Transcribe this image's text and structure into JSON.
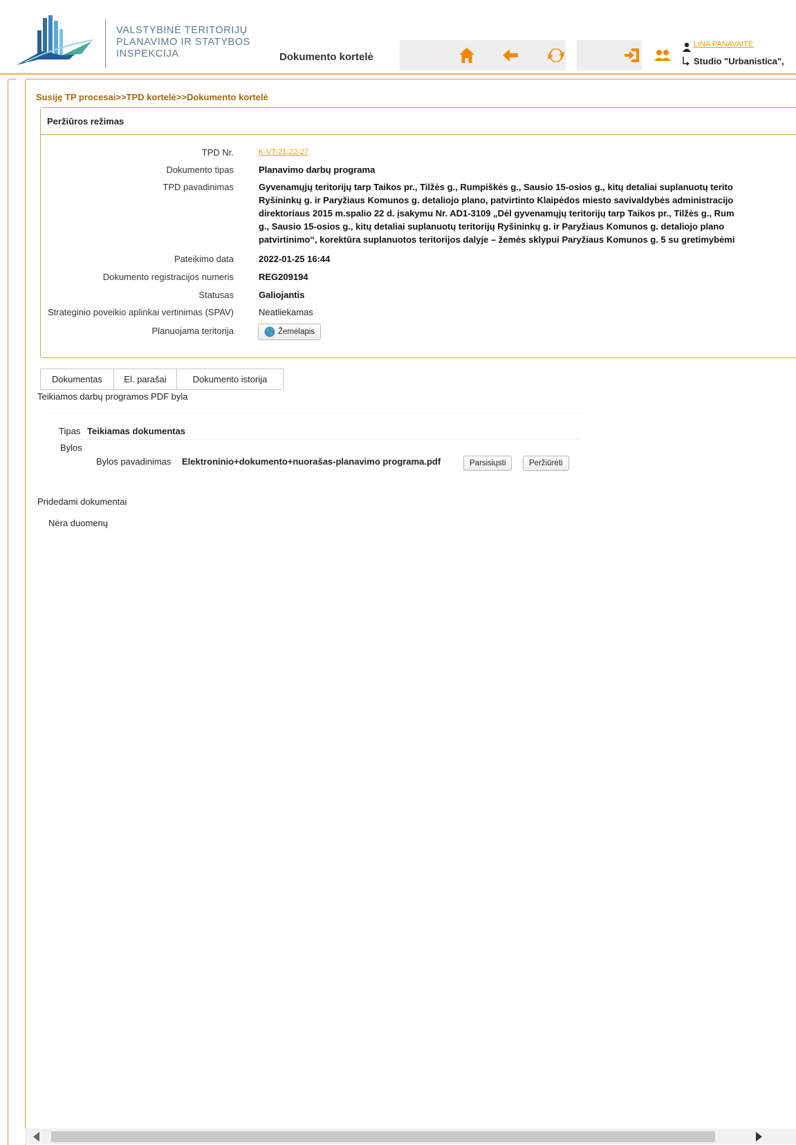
{
  "header": {
    "logo_lines": [
      "VALSTYBINĖ TERITORIJŲ",
      "PLANAVIMO IR STATYBOS",
      "INSPEKCIJA"
    ],
    "page_heading": "Dokumento kortelė",
    "user_name": "LINA PANAVAITĖ",
    "org_name": "Studio \"Urbanistica\",",
    "nav_icons": [
      "home-icon",
      "back-arrow-icon",
      "refresh-icon",
      "logout-icon",
      "users-icon"
    ],
    "accent": "#f18a00"
  },
  "breadcrumb": "Susiję TP procesai>>TPD kortelė>>Dokumento kortelė",
  "panel": {
    "title": "Peržiūros režimas",
    "fields": {
      "tpd_nr": {
        "label": "TPD Nr.",
        "value": "K-VT-21-22-27"
      },
      "doc_type": {
        "label": "Dokumento tipas",
        "value": "Planavimo darbų programa"
      },
      "tpd_name": {
        "label": "TPD pavadinimas",
        "lines": [
          "Gyvenamųjų teritorijų tarp Taikos pr., Tilžės g., Rumpiškės g., Sausio 15-osios g., kitų detaliai suplanuotų terito",
          "Ryšininkų g. ir Paryžiaus Komunos g. detaliojo plano, patvirtinto Klaipėdos miesto savivaldybės administracijo",
          "direktoriaus 2015 m.spalio 22 d. įsakymu Nr. AD1-3109 „Dėl gyvenamųjų teritorijų tarp Taikos pr., Tilžės g., Rum",
          "g., Sausio 15-osios g., kitų detaliai suplanuotų teritorijų Ryšininkų g. ir Paryžiaus Komunos g. detaliojo plano",
          "patvirtinimo“, korektūra suplanuotos teritorijos dalyje – žemės sklypui Paryžiaus Komunos g. 5 su gretimybėmi"
        ]
      },
      "submit_date": {
        "label": "Pateikimo data",
        "value": "2022-01-25 16:44"
      },
      "reg_number": {
        "label": "Dokumento registracijos numeris",
        "value": "REG209194"
      },
      "status": {
        "label": "Statusas",
        "value": "Galiojantis"
      },
      "spav": {
        "label": "Strateginio poveikio aplinkai vertinimas (SPAV)",
        "value": "Neatliekamas"
      },
      "territory": {
        "label": "Planuojama teritorija",
        "button": "Žemėlapis"
      }
    }
  },
  "tabs": [
    "Dokumentas",
    "El. parašai",
    "Dokumento istorija"
  ],
  "document_section": {
    "title": "Teikiamos darbų programos PDF byla",
    "type_label": "Tipas",
    "type_value": "Teikiamas dokumentas",
    "files_label": "Bylos",
    "file_name_label": "Bylos pavadinimas",
    "file_name": "Elektroninio+dokumento+nuorašas-planavimo programa.pdf",
    "download_button": "Parsisiųsti",
    "view_button": "Peržiūrėti"
  },
  "attached_section": {
    "title": "Pridedami dokumentai",
    "empty_text": "Nėra duomenų"
  }
}
